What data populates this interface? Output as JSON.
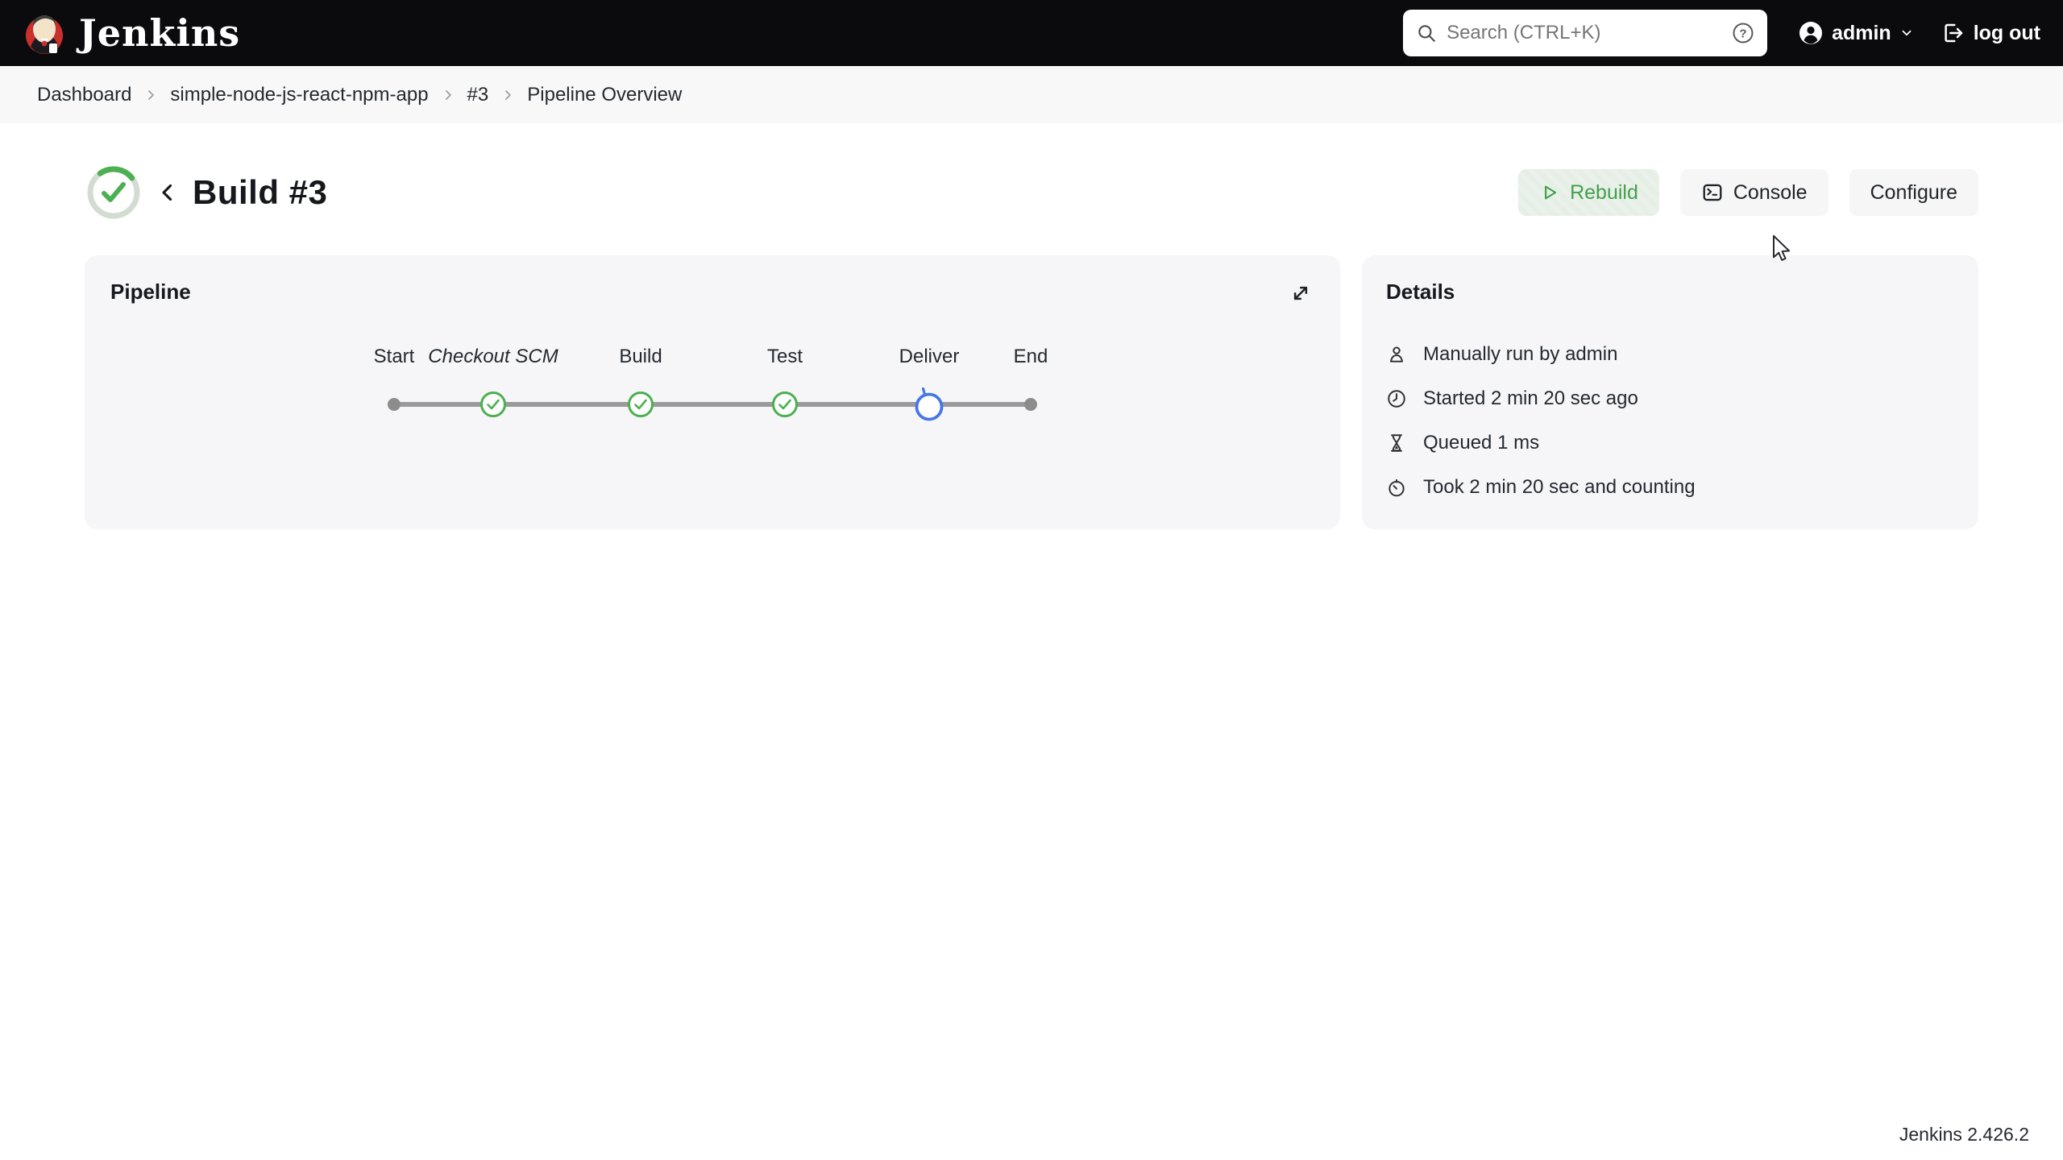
{
  "topbar": {
    "brand": "Jenkins",
    "search_placeholder": "Search (CTRL+K)",
    "user": "admin",
    "logout_label": "log out"
  },
  "breadcrumb": {
    "items": [
      "Dashboard",
      "simple-node-js-react-npm-app",
      "#3",
      "Pipeline Overview"
    ]
  },
  "build_header": {
    "title": "Build #3",
    "status": "in-progress-success",
    "buttons": [
      {
        "label": "Rebuild",
        "icon": "play-icon"
      },
      {
        "label": "Console",
        "icon": "terminal-icon"
      },
      {
        "label": "Configure",
        "icon": null
      }
    ]
  },
  "pipeline": {
    "title": "Pipeline",
    "stages": [
      {
        "name": "Start",
        "status": "terminal"
      },
      {
        "name": "Checkout SCM",
        "status": "success",
        "italic": true
      },
      {
        "name": "Build",
        "status": "success"
      },
      {
        "name": "Test",
        "status": "success"
      },
      {
        "name": "Deliver",
        "status": "running"
      },
      {
        "name": "End",
        "status": "terminal"
      }
    ]
  },
  "details": {
    "title": "Details",
    "items": [
      {
        "icon": "user-icon",
        "text": "Manually run by admin"
      },
      {
        "icon": "clock-icon",
        "text": "Started 2 min 20 sec ago"
      },
      {
        "icon": "hourglass-icon",
        "text": "Queued 1 ms"
      },
      {
        "icon": "stopwatch-icon",
        "text": "Took 2 min 20 sec and counting"
      }
    ]
  },
  "footer": {
    "version": "Jenkins 2.426.2"
  },
  "colors": {
    "topbar_black": "#0b0b0d",
    "success_green": "#4caf50",
    "running_blue": "#4577e6",
    "rebuild_green": "#43a04c",
    "node_gray": "#8c8c8c",
    "jenkins_red": "#c9302c"
  }
}
